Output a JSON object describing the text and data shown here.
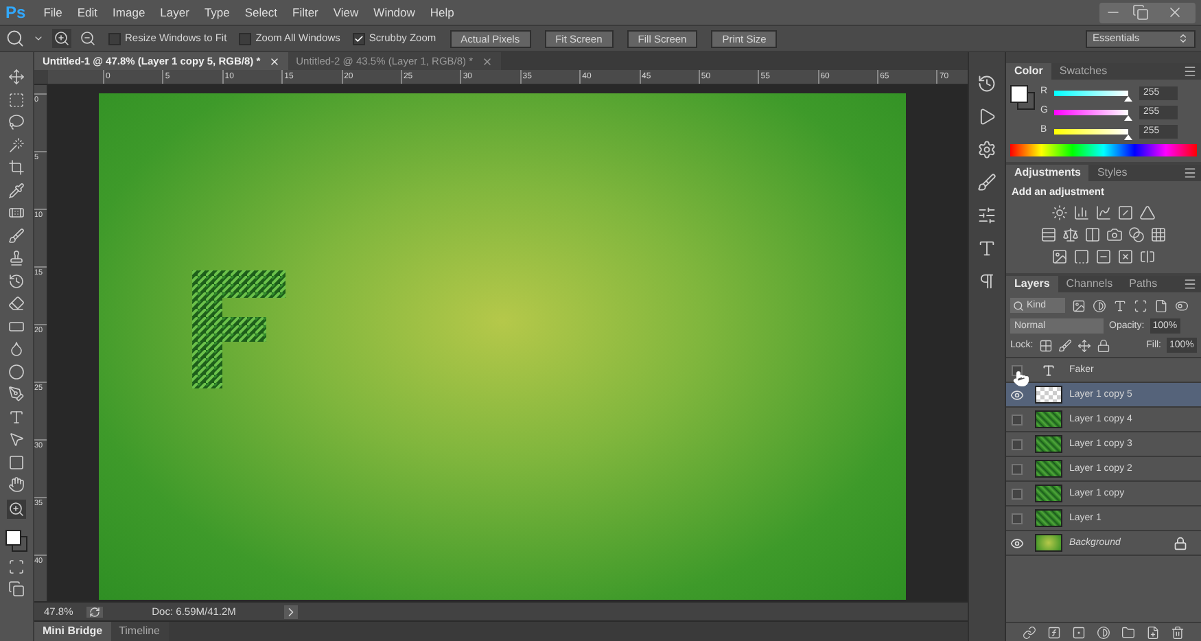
{
  "app": {
    "logo": "Ps"
  },
  "menu": [
    "File",
    "Edit",
    "Image",
    "Layer",
    "Type",
    "Select",
    "Filter",
    "View",
    "Window",
    "Help"
  ],
  "options_bar": {
    "options": [
      {
        "label": "Resize Windows to Fit",
        "checked": false
      },
      {
        "label": "Zoom All Windows",
        "checked": false
      },
      {
        "label": "Scrubby Zoom",
        "checked": true
      }
    ],
    "buttons": [
      "Actual Pixels",
      "Fit Screen",
      "Fill Screen",
      "Print Size"
    ],
    "workspace": "Essentials"
  },
  "document_tabs": [
    {
      "label": "Untitled-1 @ 47.8% (Layer 1 copy 5, RGB/8) *",
      "selected": true
    },
    {
      "label": "Untitled-2 @ 43.5% (Layer 1, RGB/8) *",
      "selected": false
    }
  ],
  "ruler": {
    "horizontal": [
      "0",
      "5",
      "10",
      "15",
      "20",
      "25",
      "30",
      "35",
      "40",
      "45",
      "50",
      "55",
      "60",
      "65",
      "70"
    ],
    "vertical": [
      "0",
      "5",
      "10",
      "15",
      "20",
      "25",
      "30",
      "35",
      "40"
    ]
  },
  "status_bar": {
    "zoom": "47.8%",
    "doc": "Doc: 6.59M/41.2M"
  },
  "bottom_tabs": [
    {
      "label": "Mini Bridge",
      "selected": true
    },
    {
      "label": "Timeline",
      "selected": false
    }
  ],
  "color_panel": {
    "tabs": [
      {
        "label": "Color",
        "selected": true
      },
      {
        "label": "Swatches",
        "selected": false
      }
    ],
    "channels": [
      {
        "name": "R",
        "value": "255",
        "level": 1,
        "kind": "red"
      },
      {
        "name": "G",
        "value": "255",
        "level": 1,
        "kind": "green"
      },
      {
        "name": "B",
        "value": "255",
        "level": 1,
        "kind": "blue"
      }
    ]
  },
  "adjustments_panel": {
    "tabs": [
      {
        "label": "Adjustments",
        "selected": true
      },
      {
        "label": "Styles",
        "selected": false
      }
    ],
    "heading": "Add an adjustment"
  },
  "layers_panel": {
    "tabs": [
      {
        "label": "Layers",
        "selected": true
      },
      {
        "label": "Channels",
        "selected": false
      },
      {
        "label": "Paths",
        "selected": false
      }
    ],
    "filter": "Kind",
    "blend_mode": "Normal",
    "opacity_label": "Opacity:",
    "opacity": "100%",
    "lock_label": "Lock:",
    "fill_label": "Fill:",
    "fill": "100%",
    "layers": [
      {
        "name": "Faker",
        "kind": "text",
        "visible": false,
        "selected": false,
        "locked": false
      },
      {
        "name": "Layer 1 copy 5",
        "kind": "transparent",
        "visible": true,
        "selected": true,
        "locked": false
      },
      {
        "name": "Layer 1 copy 4",
        "kind": "leaf",
        "visible": false,
        "selected": false,
        "locked": false
      },
      {
        "name": "Layer 1 copy 3",
        "kind": "leaf",
        "visible": false,
        "selected": false,
        "locked": false
      },
      {
        "name": "Layer 1 copy 2",
        "kind": "leaf",
        "visible": false,
        "selected": false,
        "locked": false
      },
      {
        "name": "Layer 1 copy",
        "kind": "leaf",
        "visible": false,
        "selected": false,
        "locked": false
      },
      {
        "name": "Layer 1",
        "kind": "leaf",
        "visible": false,
        "selected": false,
        "locked": false
      },
      {
        "name": "Background",
        "kind": "background",
        "visible": true,
        "selected": false,
        "locked": true
      }
    ]
  }
}
